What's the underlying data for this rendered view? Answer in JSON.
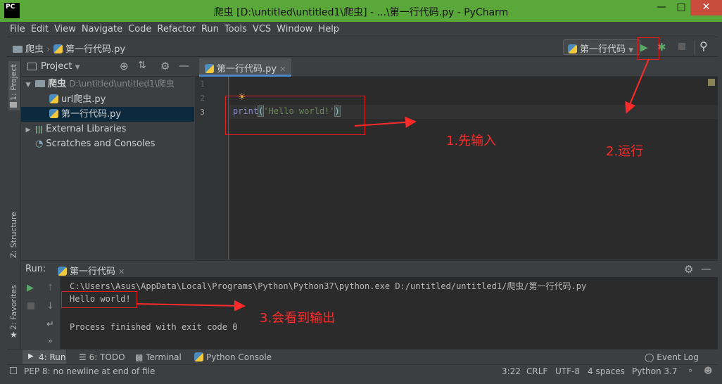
{
  "window": {
    "title": "爬虫 [D:\\untitled\\untitled1\\爬虫] - ...\\第一行代码.py - PyCharm",
    "logo": "PC"
  },
  "menu": [
    "File",
    "Edit",
    "View",
    "Navigate",
    "Code",
    "Refactor",
    "Run",
    "Tools",
    "VCS",
    "Window",
    "Help"
  ],
  "breadcrumb": {
    "project": "爬虫",
    "file": "第一行代码.py"
  },
  "run_config": "第一行代码",
  "left_stripe": {
    "project": "1: Project",
    "structure": "Z: Structure",
    "favorites": "2: Favorites"
  },
  "project_panel": {
    "title": "Project",
    "root": {
      "name": "爬虫",
      "path": "D:\\untitled\\untitled1\\爬虫"
    },
    "files": [
      "url爬虫.py",
      "第一行代码.py"
    ],
    "external": "External Libraries",
    "scratches": "Scratches and Consoles"
  },
  "editor": {
    "tab": "第一行代码.py",
    "line_numbers": [
      "1",
      "2",
      "3"
    ],
    "code": {
      "kw": "print",
      "open": "(",
      "str": "'Hello world!'",
      "close": ")"
    }
  },
  "run_panel": {
    "label": "Run:",
    "config": "第一行代码",
    "cmd": "C:\\Users\\Asus\\AppData\\Local\\Programs\\Python\\Python37\\python.exe D:/untitled/untitled1/爬虫/第一行代码.py",
    "output": "Hello world!",
    "exit": "Process finished with exit code 0"
  },
  "tool_tabs": {
    "run": "4: Run",
    "todo": "6: TODO",
    "terminal": "Terminal",
    "python_console": "Python Console",
    "event_log": "Event Log"
  },
  "status": {
    "message": "PEP 8: no newline at end of file",
    "position": "3:22",
    "line_sep": "CRLF",
    "encoding": "UTF-8",
    "indent": "4 spaces",
    "interpreter": "Python 3.7"
  },
  "annotations": {
    "step1": "1.先输入",
    "step2": "2.运行",
    "step3": "3.会看到输出"
  },
  "colors": {
    "title_bar": "#5aa83a",
    "annotation": "#ff2a2a",
    "run_green": "#59a869"
  }
}
